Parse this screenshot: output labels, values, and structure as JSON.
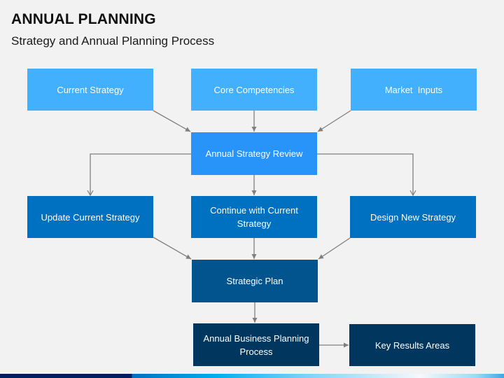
{
  "header": {
    "title": "ANNUAL PLANNING",
    "subtitle": "Strategy and Annual Planning Process"
  },
  "colors": {
    "inputs": "#42B0FD",
    "review": "#2893F8",
    "options": "#0070C0",
    "strategic_plan": "#02548E",
    "outputs": "#01375F",
    "connector": "#7F7F7F",
    "background": "#F2F2F2"
  },
  "diagram": {
    "inputs": [
      {
        "id": "current-strategy",
        "label": "Current Strategy"
      },
      {
        "id": "core-competencies",
        "label": "Core Competencies"
      },
      {
        "id": "market-inputs",
        "label": "Market  Inputs"
      }
    ],
    "review": {
      "id": "annual-strategy-review",
      "label": "Annual Strategy Review"
    },
    "options": [
      {
        "id": "update-current-strategy",
        "label": "Update Current Strategy"
      },
      {
        "id": "continue-current-strategy",
        "label": "Continue with Current Strategy"
      },
      {
        "id": "design-new-strategy",
        "label": "Design New Strategy"
      }
    ],
    "strategic_plan": {
      "id": "strategic-plan",
      "label": "Strategic Plan"
    },
    "outputs": [
      {
        "id": "annual-business-planning",
        "label": "Annual Business Planning Process"
      },
      {
        "id": "key-results-areas",
        "label": "Key Results Areas"
      }
    ],
    "edges": [
      [
        "current-strategy",
        "annual-strategy-review"
      ],
      [
        "core-competencies",
        "annual-strategy-review"
      ],
      [
        "market-inputs",
        "annual-strategy-review"
      ],
      [
        "annual-strategy-review",
        "update-current-strategy"
      ],
      [
        "annual-strategy-review",
        "continue-current-strategy"
      ],
      [
        "annual-strategy-review",
        "design-new-strategy"
      ],
      [
        "update-current-strategy",
        "strategic-plan"
      ],
      [
        "continue-current-strategy",
        "strategic-plan"
      ],
      [
        "design-new-strategy",
        "strategic-plan"
      ],
      [
        "strategic-plan",
        "annual-business-planning"
      ],
      [
        "annual-business-planning",
        "key-results-areas"
      ]
    ]
  }
}
